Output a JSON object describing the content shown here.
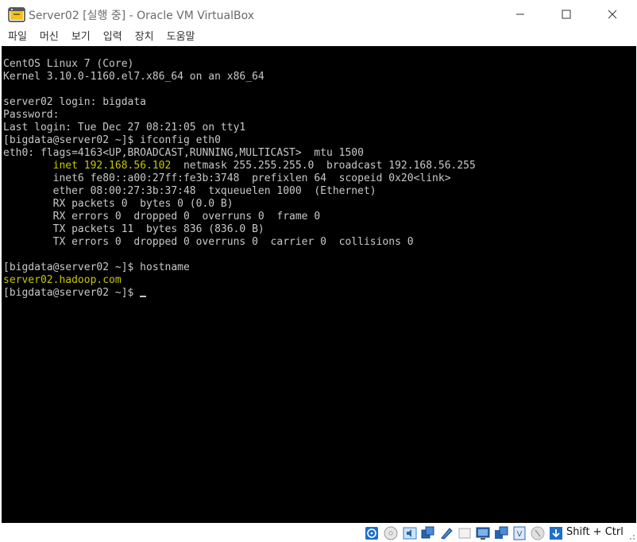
{
  "window": {
    "title": "Server02 [실행 중] - Oracle VM VirtualBox"
  },
  "menu": {
    "items": [
      "파일",
      "머신",
      "보기",
      "입력",
      "장치",
      "도움말"
    ]
  },
  "terminal": {
    "lines": [
      "CentOS Linux 7 (Core)",
      "Kernel 3.10.0-1160.el7.x86_64 on an x86_64",
      "",
      "server02 login: bigdata",
      "Password:",
      "Last login: Tue Dec 27 08:21:05 on tty1",
      "[bigdata@server02 ~]$ ifconfig eth0",
      "eth0: flags=4163<UP,BROADCAST,RUNNING,MULTICAST>  mtu 1500"
    ],
    "inet_prefix": "        inet ",
    "inet_addr": "192.168.56.102",
    "inet_rest": "  netmask 255.255.255.0  broadcast 192.168.56.255",
    "lines2": [
      "        inet6 fe80::a00:27ff:fe3b:3748  prefixlen 64  scopeid 0x20<link>",
      "        ether 08:00:27:3b:37:48  txqueuelen 1000  (Ethernet)",
      "        RX packets 0  bytes 0 (0.0 B)",
      "        RX errors 0  dropped 0  overruns 0  frame 0",
      "        TX packets 11  bytes 836 (836.0 B)",
      "        TX errors 0  dropped 0 overruns 0  carrier 0  collisions 0",
      "",
      "[bigdata@server02 ~]$ hostname"
    ],
    "hostname_output": "server02.hadoop.com",
    "prompt": "[bigdata@server02 ~]$ "
  },
  "statusbar": {
    "host_key": "Shift + Ctrl",
    "icons": [
      "hard-disk-icon",
      "optical-drive-icon",
      "audio-icon",
      "network-icon",
      "usb-icon",
      "shared-folders-icon",
      "display-icon",
      "recording-icon",
      "cpu-icon",
      "mouse-integration-icon",
      "keyboard-capture-icon"
    ]
  }
}
